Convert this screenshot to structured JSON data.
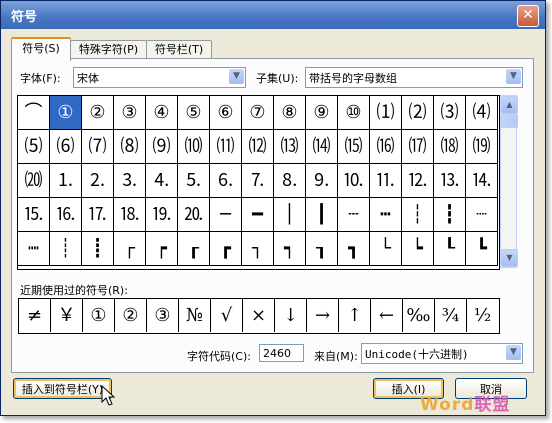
{
  "window": {
    "title": "符号",
    "close_glyph": "✕"
  },
  "tabs": [
    {
      "label": "符号(S)",
      "active": true
    },
    {
      "label": "特殊字符(P)",
      "active": false
    },
    {
      "label": "符号栏(T)",
      "active": false
    }
  ],
  "font": {
    "label": "字体(F):",
    "value": "宋体"
  },
  "subset": {
    "label": "子集(U):",
    "value": "带括号的字母数组"
  },
  "symbol_grid": {
    "rows": [
      [
        "⌒",
        "①",
        "②",
        "③",
        "④",
        "⑤",
        "⑥",
        "⑦",
        "⑧",
        "⑨",
        "⑩",
        "⑴",
        "⑵",
        "⑶",
        "⑷"
      ],
      [
        "⑸",
        "⑹",
        "⑺",
        "⑻",
        "⑼",
        "⑽",
        "⑾",
        "⑿",
        "⒀",
        "⒁",
        "⒂",
        "⒃",
        "⒄",
        "⒅",
        "⒆"
      ],
      [
        "⒇",
        "⒈",
        "⒉",
        "⒊",
        "⒋",
        "⒌",
        "⒍",
        "⒎",
        "⒏",
        "⒐",
        "⒑",
        "⒒",
        "⒓",
        "⒔",
        "⒕"
      ],
      [
        "⒖",
        "⒗",
        "⒘",
        "⒙",
        "⒚",
        "⒛",
        "─",
        "━",
        "│",
        "┃",
        "┄",
        "┅",
        "┆",
        "┇",
        "┈"
      ],
      [
        "┉",
        "┊",
        "┋",
        "┌",
        "┍",
        "┎",
        "┏",
        "┐",
        "┑",
        "┒",
        "┓",
        "└",
        "┕",
        "┖",
        "┗"
      ]
    ],
    "selected": {
      "row": 0,
      "col": 1
    }
  },
  "scrollbar": {
    "up_glyph": "▲",
    "down_glyph": "▼"
  },
  "recent": {
    "label": "近期使用过的符号(R):",
    "symbols": [
      "≠",
      "￥",
      "①",
      "②",
      "③",
      "№",
      "√",
      "×",
      "↓",
      "→",
      "↑",
      "←",
      "‰",
      "¾",
      "½"
    ]
  },
  "char_code": {
    "label": "字符代码(C):",
    "value": "2460"
  },
  "from": {
    "label": "来自(M):",
    "value": "Unicode(十六进制)"
  },
  "buttons": {
    "insert_to_bar": "插入到符号栏(Y)",
    "insert": "插入(I)",
    "cancel": "取消"
  },
  "watermark": {
    "part1": "Word",
    "part2": "联盟"
  }
}
